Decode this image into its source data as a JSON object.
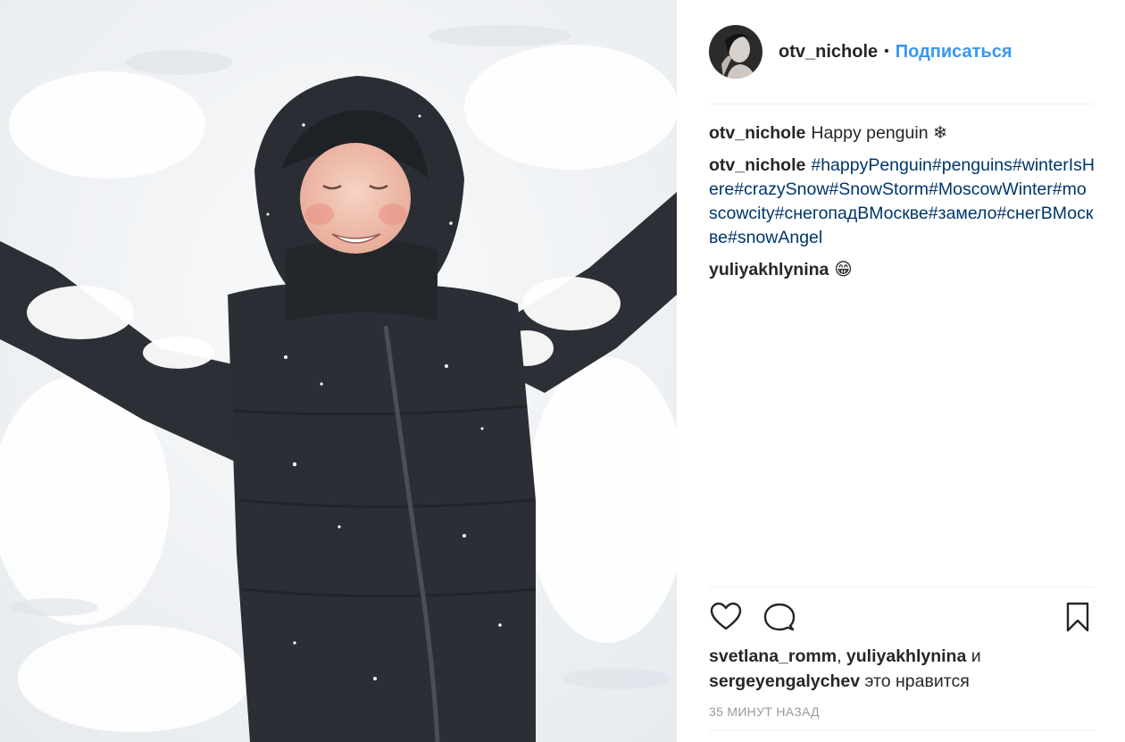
{
  "post": {
    "photo_alt": "",
    "author": {
      "username": "otv_nichole",
      "separator": "•",
      "follow_label": "Подписаться",
      "avatar_icon": "profile-photo"
    },
    "comments": [
      {
        "author": "otv_nichole",
        "text": "Happy penguin ❄",
        "kind": "caption"
      },
      {
        "author": "otv_nichole",
        "text": "#happyPenguin#penguins#winterIsHere#crazySnow#SnowStorm#MoscowWinter#moscowcity#снегопадВМоскве#замело#снегВМоскве#snowAngel",
        "kind": "hashtags"
      },
      {
        "author": "yuliyakhlynina",
        "text": "😁",
        "kind": "reply"
      }
    ],
    "actions": {
      "like_icon": "heart-icon",
      "comment_icon": "comment-bubble-icon",
      "save_icon": "bookmark-icon"
    },
    "likes": {
      "user1": "svetlana_romm",
      "sep": ",",
      "user2": "yuliyakhlynina",
      "and_word": "и",
      "user3": "sergeyengalychev",
      "suffix": "это нравится"
    },
    "timestamp": "35 минут назад"
  },
  "colors": {
    "link": "#3897f0",
    "hashtag": "#003569",
    "text": "#262626",
    "muted": "#999999",
    "divider": "#efefef"
  }
}
